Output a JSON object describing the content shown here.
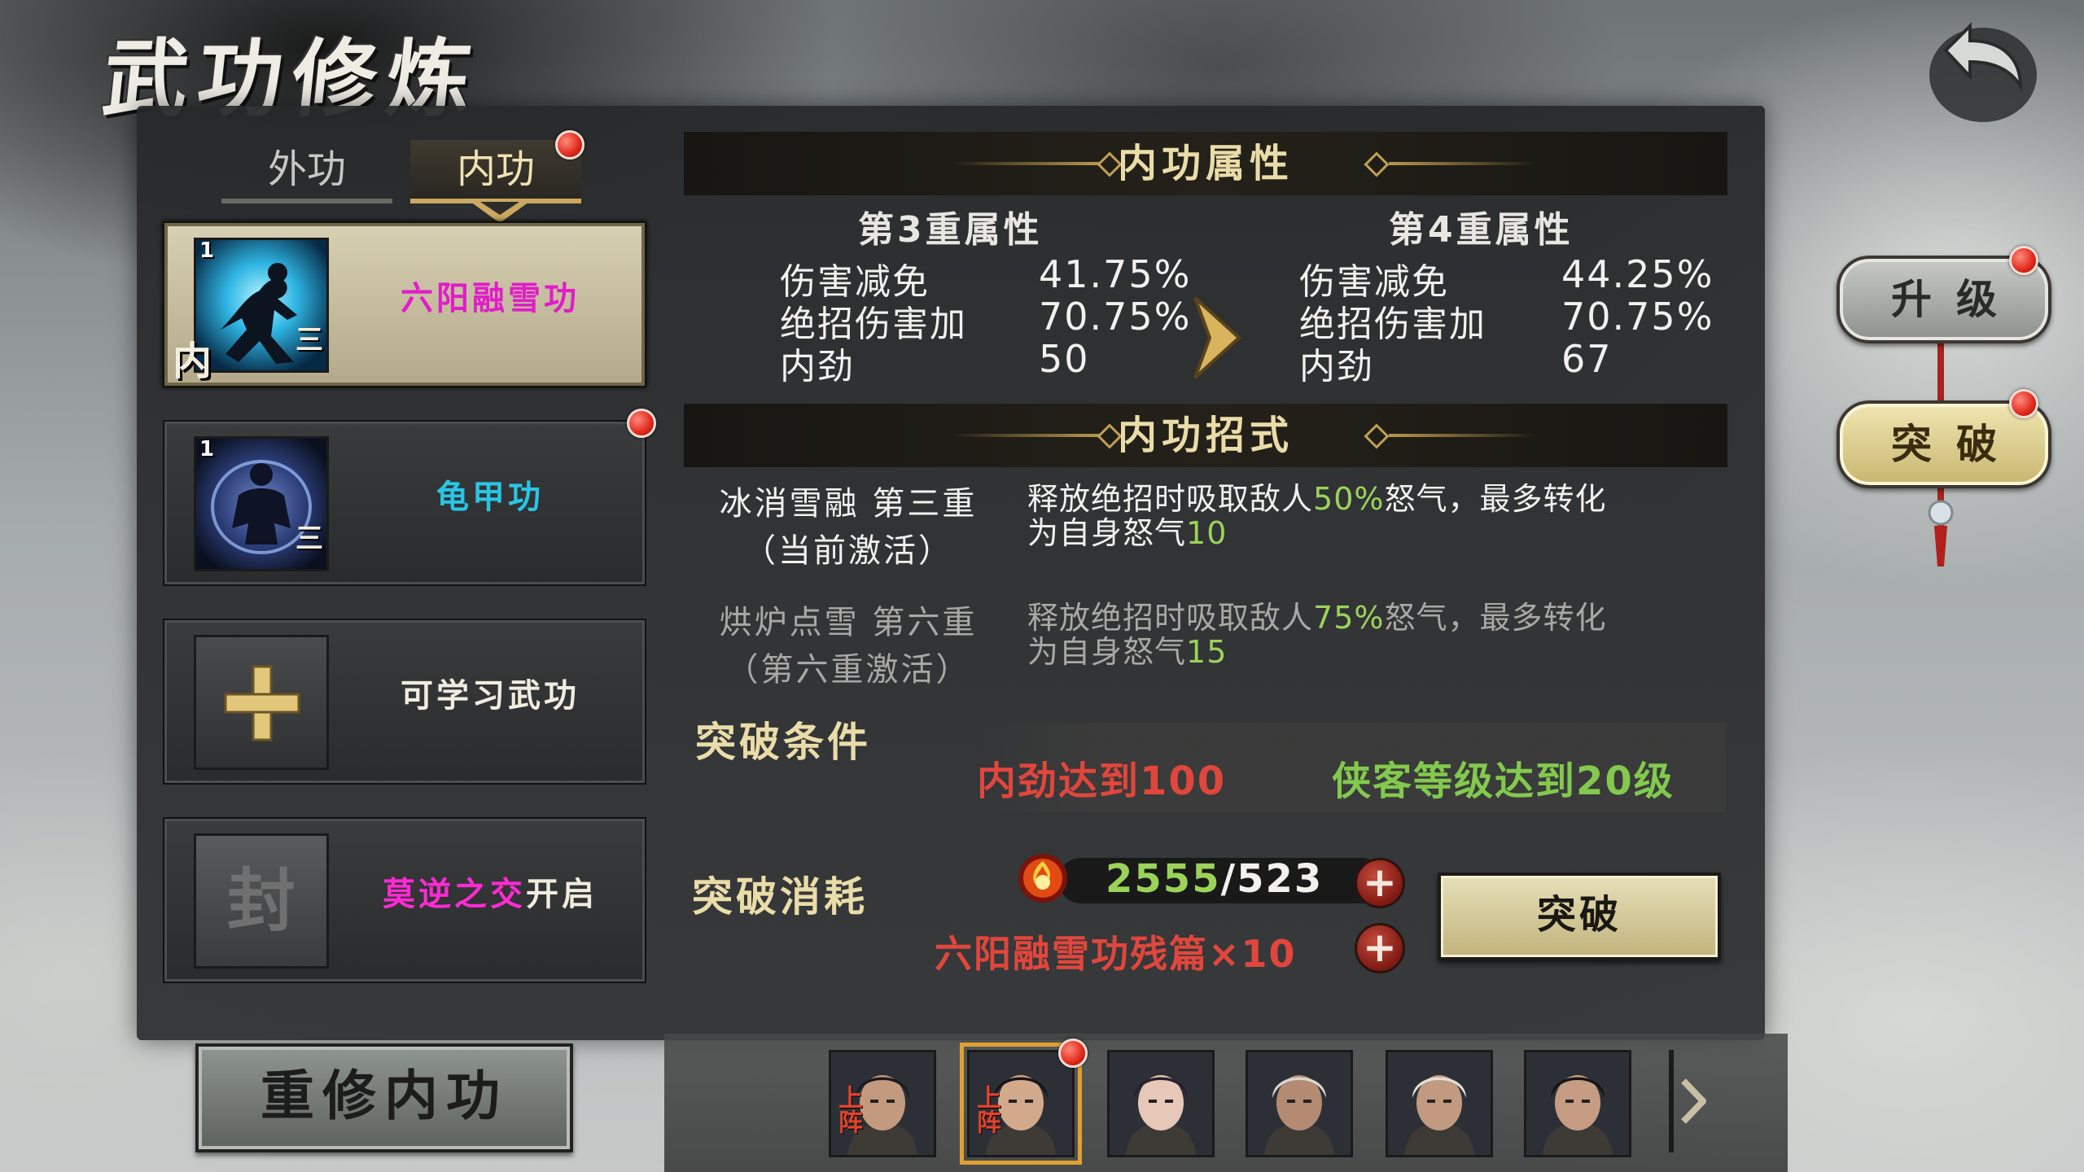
{
  "page": {
    "title": "武功修炼"
  },
  "tabs": [
    {
      "label": "外功",
      "active": false
    },
    {
      "label": "内功",
      "active": true
    }
  ],
  "skills": [
    {
      "name": "六阳融雪功",
      "level": "1",
      "grade": "三",
      "tag": "内",
      "name_color": "#e01ec8",
      "selected": true,
      "badge": false
    },
    {
      "name": "龟甲功",
      "level": "1",
      "grade": "三",
      "tag": "",
      "name_color": "#28c6e6",
      "selected": false,
      "badge": true
    },
    {
      "name": "可学习武功",
      "name_color": "#f0ece0",
      "type": "add"
    },
    {
      "name_highlight": "莫逆之交",
      "name_suffix": "开启",
      "name_color": "#ff2ad4",
      "type": "locked",
      "lock_char": "封"
    }
  ],
  "reset_button": "重修内功",
  "attributes": {
    "section_title": "内功属性",
    "current": {
      "header": "第3重属性",
      "rows": [
        {
          "label": "伤害减免",
          "value": "41.75%"
        },
        {
          "label": "绝招伤害加",
          "value": "70.75%"
        },
        {
          "label": "内劲",
          "value": "50"
        }
      ]
    },
    "next": {
      "header": "第4重属性",
      "rows": [
        {
          "label": "伤害减免",
          "value": "44.25%"
        },
        {
          "label": "绝招伤害加",
          "value": "70.75%"
        },
        {
          "label": "内劲",
          "value": "67"
        }
      ]
    }
  },
  "moves": {
    "section_title": "内功招式",
    "items": [
      {
        "name_line1": "冰消雪融 第三重",
        "name_line2": "（当前激活）",
        "desc_a": "释放绝招时吸取敌人",
        "desc_pct": "50%",
        "desc_b": "怒气，最多转化",
        "desc_c": "为自身怒气",
        "desc_val": "10",
        "active": true
      },
      {
        "name_line1": "烘炉点雪 第六重",
        "name_line2": "（第六重激活）",
        "desc_a": "释放绝招时吸取敌人",
        "desc_pct": "75%",
        "desc_b": "怒气，最多转化",
        "desc_c": "为自身怒气",
        "desc_val": "15",
        "active": false
      }
    ]
  },
  "breakthrough": {
    "conditions_title": "突破条件",
    "condition_1": "内劲达到100",
    "condition_2": "侠客等级达到20级",
    "cost_title": "突破消耗",
    "cost_have": "2555",
    "cost_sep": "/",
    "cost_need": "523",
    "fragment_text": "六阳融雪功残篇×10",
    "button": "突破",
    "plus_label": "+"
  },
  "side_buttons": {
    "upgrade": "升级",
    "break": "突破"
  },
  "portraits": [
    {
      "deploy": "上阵",
      "selected": false,
      "badge": false,
      "hair": "#1b1b1e",
      "skin": "#c49a7e"
    },
    {
      "deploy": "上阵",
      "selected": true,
      "badge": true,
      "hair": "#151517",
      "skin": "#d2a98a"
    },
    {
      "deploy": "",
      "selected": false,
      "badge": false,
      "hair": "#2a1f2e",
      "skin": "#e6c7b8"
    },
    {
      "deploy": "",
      "selected": false,
      "badge": false,
      "hair": "#d8d6d2",
      "skin": "#b48a72"
    },
    {
      "deploy": "",
      "selected": false,
      "badge": false,
      "hair": "#e2dfd8",
      "skin": "#c19a80"
    },
    {
      "deploy": "",
      "selected": false,
      "badge": false,
      "hair": "#141416",
      "skin": "#c69c82"
    }
  ],
  "colors": {
    "gold": "#eadca8",
    "green": "#9bd35a",
    "red": "#e0463c"
  }
}
